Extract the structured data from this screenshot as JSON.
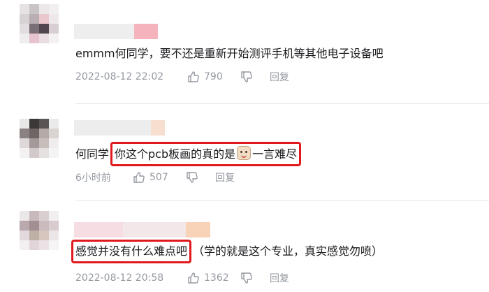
{
  "icons": {
    "like": "thumb-up-icon",
    "dislike": "thumb-down-icon",
    "emoji": "pig-face-emoji-icon"
  },
  "comments": [
    {
      "content": "emmm何同学，要不还是重新开始测评手机等其他电子设备吧",
      "time": "2022-08-12 22:02",
      "likes": "790",
      "reply_label": "回复"
    },
    {
      "content_prefix": "何同学",
      "content_highlight_a": "你这个pcb板画的真的是",
      "content_highlight_b": "一言难尽",
      "time": "6小时前",
      "likes": "507",
      "reply_label": "回复"
    },
    {
      "content_highlight": "感觉并没有什么难点吧",
      "content_suffix": "（学的就是这个专业，真实感觉勿喷）",
      "time": "2022-08-12 20:58",
      "likes": "1362",
      "reply_label": "回复"
    }
  ],
  "colors": {
    "highlight_box": "#e0191c",
    "meta_text": "#9499a0",
    "content_text": "#18191c"
  }
}
